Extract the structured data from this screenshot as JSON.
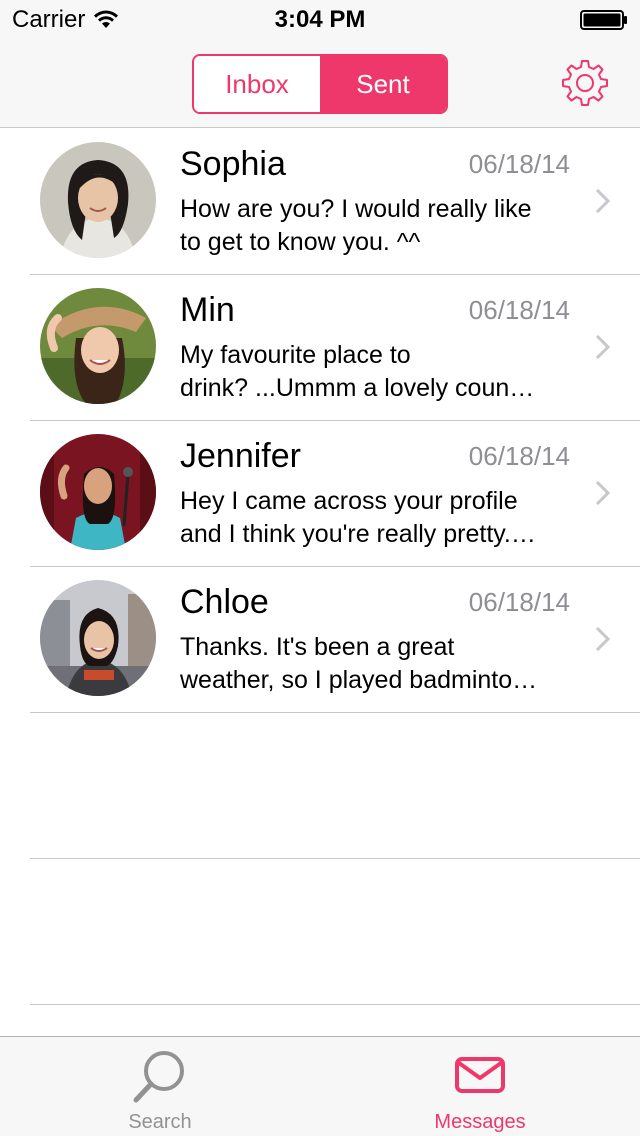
{
  "status_bar": {
    "carrier": "Carrier",
    "time": "3:04 PM"
  },
  "nav": {
    "segments": [
      "Inbox",
      "Sent"
    ],
    "selected_segment": "Sent"
  },
  "messages": [
    {
      "name": "Sophia",
      "date": "06/18/14",
      "preview_line1": "How are you? I would really like",
      "preview_line2": "to get to know you. ^^"
    },
    {
      "name": "Min",
      "date": "06/18/14",
      "preview_line1": "My favourite place to",
      "preview_line2": "drink? ...Ummm a lovely coun…"
    },
    {
      "name": "Jennifer",
      "date": "06/18/14",
      "preview_line1": "Hey I came across your profile",
      "preview_line2": "and I think you're really pretty.…"
    },
    {
      "name": "Chloe",
      "date": "06/18/14",
      "preview_line1": "Thanks. It's been a great",
      "preview_line2": "weather, so I played badminto…"
    }
  ],
  "tab_bar": {
    "tabs": [
      {
        "label": "Search",
        "icon": "search-icon"
      },
      {
        "label": "Messages",
        "icon": "envelope-icon"
      }
    ],
    "selected": "Messages"
  },
  "colors": {
    "accent": "#ee386c",
    "secondary_text": "#8e8e93",
    "separator": "#c8c7cc",
    "bar_background": "#f7f7f7"
  }
}
